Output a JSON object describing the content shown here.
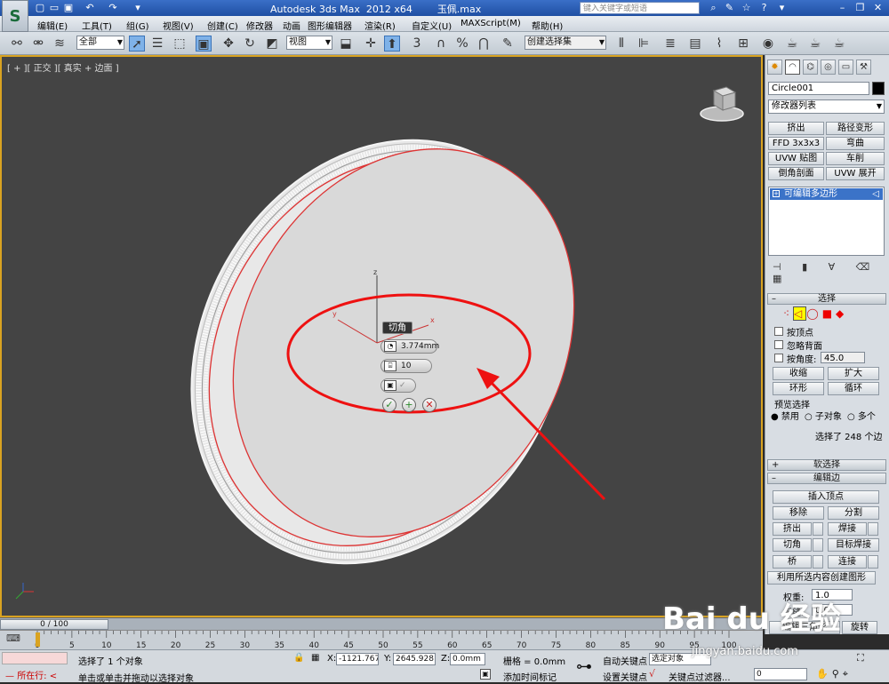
{
  "title": {
    "app": "Autodesk 3ds Max  2012 x64",
    "file": "玉佩.max",
    "search_placeholder": "键入关键字或短语"
  },
  "menu": [
    "编辑(E)",
    "工具(T)",
    "组(G)",
    "视图(V)",
    "创建(C)",
    "修改器",
    "动画",
    "图形编辑器",
    "渲染(R)",
    "自定义(U)",
    "MAXScript(M)",
    "帮助(H)"
  ],
  "toolbar": {
    "selection_filter": "全部",
    "ref_coord": "视图",
    "snap_number": "3",
    "named_selection": "创建选择集"
  },
  "viewport": {
    "label": "[ + ][ 正交 ][ 真实 + 边面 ]",
    "axis_x": "x",
    "axis_y": "y",
    "axis_z": "z",
    "caddy": {
      "title": "切角",
      "amount": "3.774mm",
      "segments": "10",
      "ok_icon": "✓",
      "apply_icon": "+",
      "cancel_icon": "✕"
    }
  },
  "panel": {
    "object_name": "Circle001",
    "modifier_list": "修改器列表",
    "buttons": [
      [
        "挤出",
        "路径变形"
      ],
      [
        "FFD 3x3x3",
        "弯曲"
      ],
      [
        "UVW 贴图",
        "车削"
      ],
      [
        "倒角剖面",
        "UVW 展开"
      ]
    ],
    "stack_item": "可编辑多边形",
    "selection_rollout": "选择",
    "by_vertex": "按顶点",
    "ignore_backfacing": "忽略背面",
    "by_angle": "按角度:",
    "angle_value": "45.0",
    "shrink": "收缩",
    "grow": "扩大",
    "ring": "环形",
    "loop": "循环",
    "preview_selection": "预览选择",
    "preview_disabled": "禁用",
    "preview_subobject": "子对象",
    "preview_multi": "多个",
    "selected_info": "选择了 248 个边",
    "soft_selection": "软选择",
    "edit_edges": "编辑边",
    "insert_vertex": "插入顶点",
    "remove": "移除",
    "split": "分割",
    "extrude": "挤出",
    "weld": "焊接",
    "chamfer": "切角",
    "target_weld": "目标焊接",
    "bridge": "桥",
    "connect": "连接",
    "create_shape": "利用所选内容创建图形",
    "weight_label": "权重:",
    "weight_value": "1.0",
    "crease_label": "折缝:",
    "crease_value": "0.0",
    "edit_tri": "编辑三角形",
    "turn": "旋转"
  },
  "timeline": {
    "frame": "0 / 100",
    "ticks": [
      "0",
      "5",
      "10",
      "15",
      "20",
      "25",
      "30",
      "35",
      "40",
      "45",
      "50",
      "55",
      "60",
      "65",
      "70",
      "75",
      "80",
      "85",
      "90",
      "95",
      "100"
    ]
  },
  "status": {
    "running": "所在行:",
    "selected": "选择了 1 个对象",
    "prompt": "单击或单击并拖动以选择对象",
    "x_label": "X:",
    "x_value": "-1121.767",
    "y_label": "Y:",
    "y_value": "2645.928",
    "z_label": "Z:",
    "z_value": "0.0mm",
    "grid": "栅格 = 0.0mm",
    "add_time_tag": "添加时间标记",
    "auto_key": "自动关键点",
    "set_key": "设置关键点",
    "selected_obj": "选定对象",
    "key_filters": "关键点过滤器...",
    "frame_value": "0"
  },
  "watermark": {
    "logo": "Bai du 经验",
    "url": "jingyan.baidu.com"
  }
}
